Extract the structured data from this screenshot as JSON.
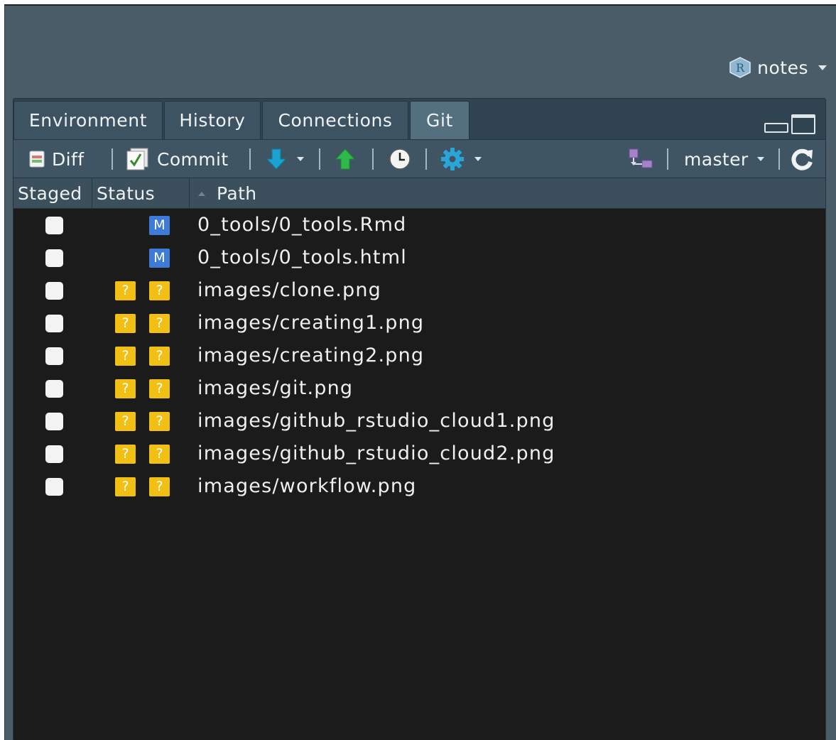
{
  "project": {
    "name": "notes",
    "icon": "r-project-icon",
    "icon_letter": "R"
  },
  "tabs": [
    {
      "label": "Environment",
      "active": false
    },
    {
      "label": "History",
      "active": false
    },
    {
      "label": "Connections",
      "active": false
    },
    {
      "label": "Git",
      "active": true
    }
  ],
  "toolbar": {
    "diff_label": "Diff",
    "commit_label": "Commit",
    "branch": "master"
  },
  "columns": {
    "staged": "Staged",
    "status": "Status",
    "path": "Path"
  },
  "files": [
    {
      "path": "0_tools/0_tools.Rmd",
      "staged_status": "",
      "unstaged_status": "M"
    },
    {
      "path": "0_tools/0_tools.html",
      "staged_status": "",
      "unstaged_status": "M"
    },
    {
      "path": "images/clone.png",
      "staged_status": "?",
      "unstaged_status": "?"
    },
    {
      "path": "images/creating1.png",
      "staged_status": "?",
      "unstaged_status": "?"
    },
    {
      "path": "images/creating2.png",
      "staged_status": "?",
      "unstaged_status": "?"
    },
    {
      "path": "images/git.png",
      "staged_status": "?",
      "unstaged_status": "?"
    },
    {
      "path": "images/github_rstudio_cloud1.png",
      "staged_status": "?",
      "unstaged_status": "?"
    },
    {
      "path": "images/github_rstudio_cloud2.png",
      "staged_status": "?",
      "unstaged_status": "?"
    },
    {
      "path": "images/workflow.png",
      "staged_status": "?",
      "unstaged_status": "?"
    }
  ],
  "colors": {
    "modified": "#3d7bd6",
    "untracked": "#f2c014",
    "pull_arrow": "#1aa3d1",
    "push_arrow": "#2fb94a"
  }
}
